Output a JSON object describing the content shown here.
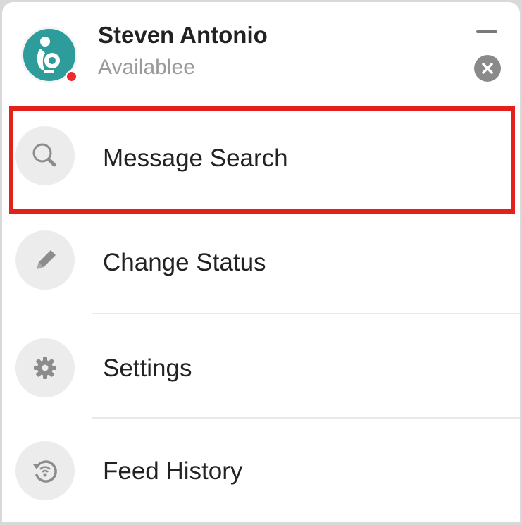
{
  "user": {
    "name": "Steven Antonio",
    "status": "Availablee",
    "presence_color": "#ee2b2b",
    "avatar_color": "#2e9c9a"
  },
  "window_controls": {
    "minimize_icon": "minimize-icon",
    "close_icon": "close-icon"
  },
  "menu": {
    "items": [
      {
        "label": "Message Search",
        "icon": "search-icon",
        "highlighted": true
      },
      {
        "label": "Change Status",
        "icon": "pencil-icon",
        "highlighted": false
      },
      {
        "label": "Settings",
        "icon": "gear-icon",
        "highlighted": false
      },
      {
        "label": "Feed History",
        "icon": "history-icon",
        "highlighted": false
      }
    ]
  },
  "colors": {
    "highlight_border": "#e3201b",
    "icon_circle": "#ececec",
    "icon_glyph": "#8c8c8c"
  }
}
